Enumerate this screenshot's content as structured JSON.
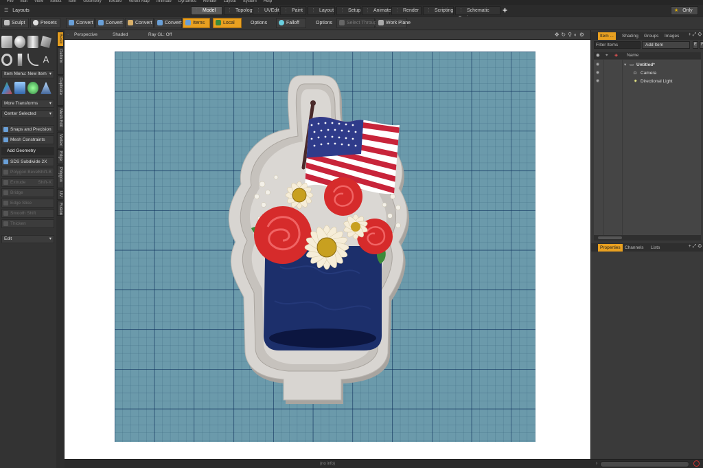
{
  "menu": [
    "File",
    "Edit",
    "View",
    "Select",
    "Item",
    "Geometry",
    "Texture",
    "Vertex Map",
    "Animate",
    "Dynamics",
    "Render",
    "Layout",
    "System",
    "Help"
  ],
  "layouts_title": "Layouts",
  "layout_tabs": [
    {
      "label": "Model",
      "active": true
    },
    {
      "label": "Topology",
      "active": false
    },
    {
      "label": "UVEdit",
      "active": false
    },
    {
      "label": "Paint",
      "active": false
    },
    {
      "label": "Layout",
      "active": false
    },
    {
      "label": "Setup",
      "active": false
    },
    {
      "label": "Animate",
      "active": false
    },
    {
      "label": "Render",
      "active": false
    },
    {
      "label": "Scripting",
      "active": false
    },
    {
      "label": "Schematic Fusion",
      "active": false
    }
  ],
  "only_label": "Only",
  "toolbar": {
    "sculpt": "Sculpt",
    "presets": "Presets",
    "convert": [
      "Convert",
      "Convert",
      "Convert",
      "Convert"
    ],
    "items": "Items",
    "local": "Local",
    "options_1": "Options",
    "falloff": "Falloff",
    "options_2": "Options",
    "select_through": "Select Through",
    "work_plane": "Work Plane"
  },
  "left_tools": {
    "item_menu": "Item Menu: New Item",
    "more_transforms": "More Transforms",
    "center_selected": "Center Selected",
    "snaps": "Snaps and Precision",
    "mesh_constraints": "Mesh Constraints",
    "add_geometry": "Add Geometry",
    "sds_subdivide": "SDS Subdivide 2X",
    "polygon_bevel": "Polygon Bevel",
    "polygon_bevel_key": "Shift-B",
    "extrude": "Extrude",
    "extrude_key": "Shift-X",
    "bridge": "Bridge",
    "edge_slice": "Edge Slice",
    "smooth_shift": "Smooth Shift",
    "thicken": "Thicken",
    "edit": "Edit"
  },
  "vertical_tabs": [
    "Basic",
    "Deform",
    "Duplicate",
    "Mesh Edit",
    "Vertex",
    "Edge",
    "Polygon",
    "UV",
    "Fusion"
  ],
  "viewport": {
    "perspective": "Perspective",
    "shaded": "Shaded",
    "ray_gl": "Ray GL: Off"
  },
  "item_panel": {
    "tabs": [
      "Item ...",
      "Shading",
      "Groups",
      "Images"
    ],
    "filter_placeholder": "Filter Items",
    "add_item": "Add Item",
    "btn_e": "E",
    "btn_f": "F",
    "name_header": "Name",
    "items": [
      {
        "label": "Untitled*",
        "bold": true
      },
      {
        "label": "Camera",
        "bold": false
      },
      {
        "label": "Directional Light",
        "bold": false
      }
    ]
  },
  "properties_panel": {
    "tabs": [
      "Properties",
      "Channels",
      "Lists"
    ]
  },
  "status": {
    "text": "(no info)"
  },
  "colors": {
    "accent_orange": "#e8a020",
    "grid_blue": "#6b9aab",
    "grid_line": "#143a66",
    "cutter_grey": "#d6d3cf",
    "jar_navy": "#1c2f6b",
    "flower_red": "#d62b2b"
  }
}
